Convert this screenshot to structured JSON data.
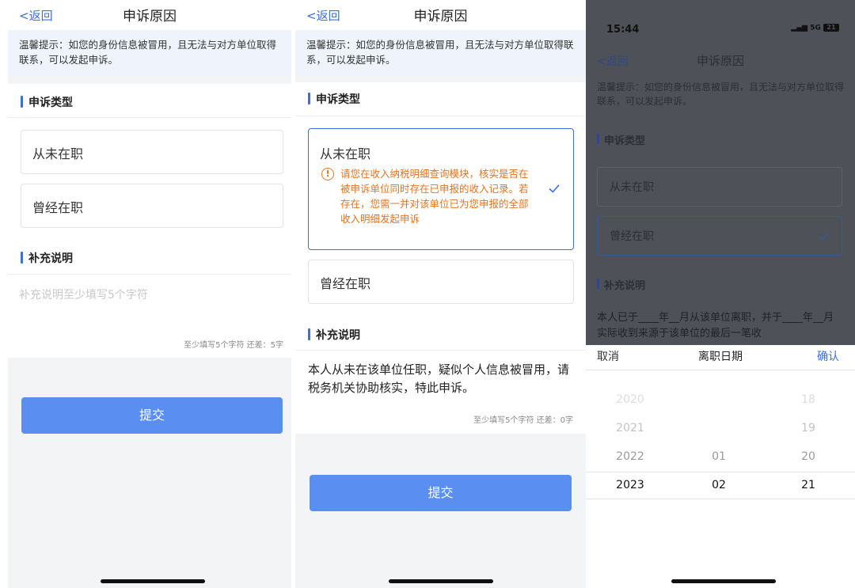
{
  "common": {
    "back_label": "<返回",
    "title": "申诉原因",
    "tip": "温馨提示：如您的身份信息被冒用，且无法与对方单位取得联系，可以发起申诉。",
    "section_type": "申诉类型",
    "section_note": "补充说明",
    "submit_label": "提交"
  },
  "screen1": {
    "options": [
      "从未在职",
      "曾经在职"
    ],
    "note_placeholder": "补充说明至少填写5个字符",
    "counter": "至少填写5个字符 还差：5字"
  },
  "screen2": {
    "options": [
      "从未在职",
      "曾经在职"
    ],
    "selected_index": 0,
    "warning": "请您在收入纳税明细查询模块，核实是否在被申诉单位同时存在已申报的收入记录。若存在，您需一并对该单位已为您申报的全部收入明细发起申诉",
    "note_text": "本人从未在该单位任职，疑似个人信息被冒用，请税务机关协助核实，特此申诉。",
    "counter": "至少填写5个字符 还差：0字"
  },
  "screen3": {
    "status_time": "15:44",
    "status_signal": "5G",
    "status_battery": "21",
    "options": [
      "从未在职",
      "曾经在职"
    ],
    "selected_index": 1,
    "note_text": "本人已于____年__月从该单位离职，并于____年__月实际收到来源于该单位的最后一笔收",
    "picker": {
      "cancel": "取消",
      "title": "离职日期",
      "confirm": "确认",
      "years": [
        "2020",
        "2021",
        "2022",
        "2023"
      ],
      "months": [
        "",
        "",
        "01",
        "02"
      ],
      "days": [
        "18",
        "19",
        "20",
        "21"
      ],
      "selected": {
        "year": "2023",
        "month": "02",
        "day": "21"
      }
    }
  },
  "colors": {
    "accent": "#3a6fe0",
    "submit": "#5a8ef0",
    "warning": "#e8731f"
  },
  "icons": {
    "check": "check-icon",
    "warning": "warning-circle-icon"
  }
}
